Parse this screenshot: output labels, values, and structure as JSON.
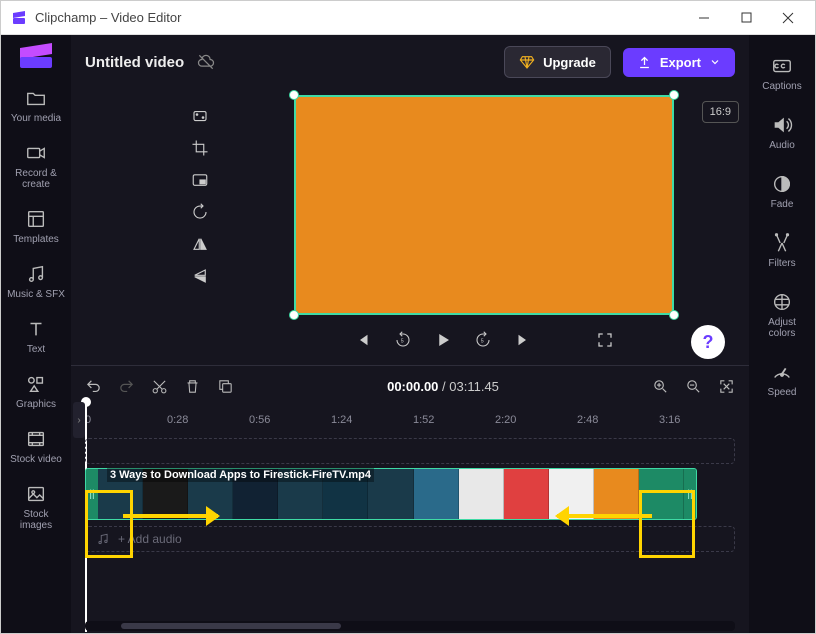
{
  "window": {
    "title": "Clipchamp – Video Editor"
  },
  "project": {
    "title": "Untitled video"
  },
  "header": {
    "upgrade": "Upgrade",
    "export": "Export"
  },
  "preview": {
    "aspect": "16:9"
  },
  "left_rail": [
    {
      "id": "your-media",
      "label": "Your media"
    },
    {
      "id": "record-create",
      "label": "Record &\ncreate"
    },
    {
      "id": "templates",
      "label": "Templates"
    },
    {
      "id": "music-sfx",
      "label": "Music & SFX"
    },
    {
      "id": "text",
      "label": "Text"
    },
    {
      "id": "graphics",
      "label": "Graphics"
    },
    {
      "id": "stock-video",
      "label": "Stock video"
    },
    {
      "id": "stock-images",
      "label": "Stock\nimages"
    }
  ],
  "right_rail": [
    {
      "id": "captions",
      "label": "Captions"
    },
    {
      "id": "audio",
      "label": "Audio"
    },
    {
      "id": "fade",
      "label": "Fade"
    },
    {
      "id": "filters",
      "label": "Filters"
    },
    {
      "id": "adjust-colors",
      "label": "Adjust\ncolors"
    },
    {
      "id": "speed",
      "label": "Speed"
    }
  ],
  "timeline": {
    "current_time": "00:00.00",
    "total_time": "03:11.45",
    "ticks": [
      "0",
      "0:28",
      "0:56",
      "1:24",
      "1:52",
      "2:20",
      "2:48",
      "3:16"
    ],
    "clip_name": "3 Ways to Download Apps to Firestick-FireTV.mp4",
    "add_audio": "+ Add audio"
  },
  "help": "?"
}
